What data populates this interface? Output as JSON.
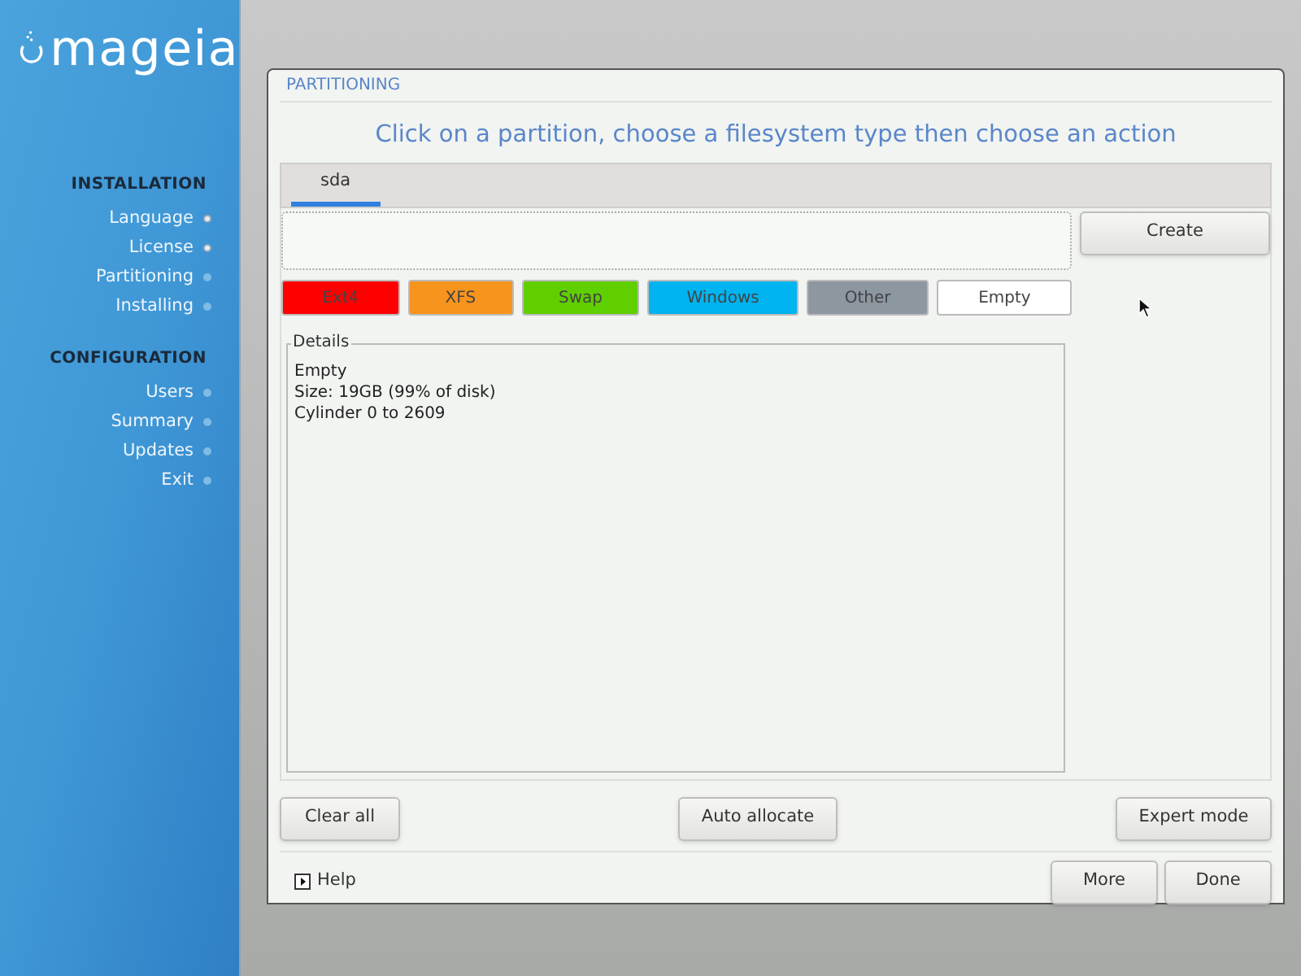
{
  "logo": {
    "text": "mageia"
  },
  "sidebar": {
    "sections": [
      {
        "title": "INSTALLATION",
        "items": [
          {
            "label": "Language",
            "done": true
          },
          {
            "label": "License",
            "done": true
          },
          {
            "label": "Partitioning",
            "done": false
          },
          {
            "label": "Installing",
            "done": false
          }
        ]
      },
      {
        "title": "CONFIGURATION",
        "items": [
          {
            "label": "Users",
            "done": false
          },
          {
            "label": "Summary",
            "done": false
          },
          {
            "label": "Updates",
            "done": false
          },
          {
            "label": "Exit",
            "done": false
          }
        ]
      }
    ]
  },
  "dialog": {
    "title": "PARTITIONING",
    "instruction": "Click on a partition, choose a filesystem type then choose an action",
    "tabs": [
      {
        "label": "sda",
        "selected": true
      }
    ],
    "legend": [
      {
        "label": "Ext4",
        "color": "#ff0000"
      },
      {
        "label": "XFS",
        "color": "#f7941d"
      },
      {
        "label": "Swap",
        "color": "#5fcf00"
      },
      {
        "label": "Windows",
        "color": "#00b4f0"
      },
      {
        "label": "Other",
        "color": "#8c97a0"
      },
      {
        "label": "Empty",
        "color": "#ffffff"
      }
    ],
    "side_buttons": [
      "Create"
    ],
    "details": {
      "title": "Details",
      "lines": [
        "Empty",
        "Size: 19GB (99% of disk)",
        "Cylinder 0 to 2609"
      ]
    },
    "action_buttons": [
      "Clear all",
      "Auto allocate",
      "Expert mode"
    ],
    "help": "Help",
    "bottom_buttons": [
      "More",
      "Done"
    ]
  }
}
